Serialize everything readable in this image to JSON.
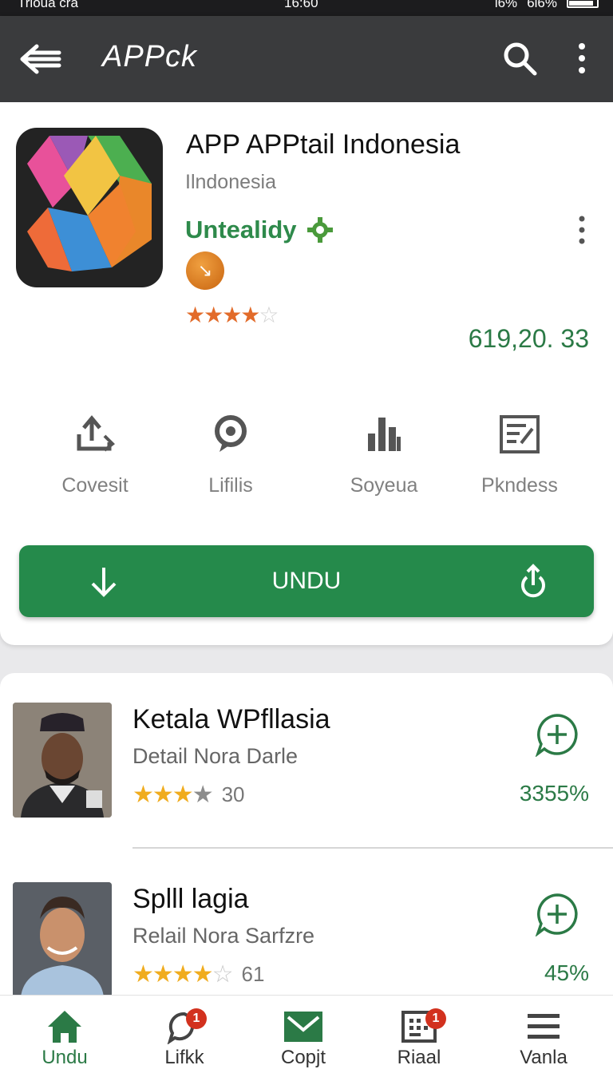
{
  "status_bar": {
    "carrier": "Trioua cra",
    "time": "16:60",
    "signal_text": "l6%",
    "battery_text": "6l6%"
  },
  "app_bar": {
    "title": "APPck"
  },
  "app": {
    "name": "APP APPtail Indonesia",
    "subtitle": "Ilndonesia",
    "developer": "Untealidy",
    "rating": 4,
    "rating_max": 5,
    "price": "619,20. 33",
    "icon": "app-logo-icon",
    "brand_color": "#2e8a4b"
  },
  "actions": [
    {
      "label": "Covesit",
      "icon": "share-upload-icon"
    },
    {
      "label": "Lifilis",
      "icon": "location-pin-icon"
    },
    {
      "label": "Soyeua",
      "icon": "bar-chart-icon"
    },
    {
      "label": "Pkndess",
      "icon": "edit-note-icon"
    }
  ],
  "download_button": {
    "label": "UNDU",
    "color": "#258a4b"
  },
  "list": [
    {
      "name": "Ketala WPfllasia",
      "detail": "Detail Nora Darle",
      "rating": 3.5,
      "count": "30",
      "percent": "3355%"
    },
    {
      "name": "Splll lagia",
      "detail": "Relail Nora Sarfzre",
      "rating": 4,
      "count": "61",
      "percent": "45%"
    }
  ],
  "bottom_nav": [
    {
      "label": "Undu",
      "icon": "home-icon",
      "active": true,
      "badge": ""
    },
    {
      "label": "Lifkk",
      "icon": "chat-icon",
      "active": false,
      "badge": "1"
    },
    {
      "label": "Copjt",
      "icon": "mail-icon",
      "active": false,
      "badge": ""
    },
    {
      "label": "Riaal",
      "icon": "grid-icon",
      "active": false,
      "badge": "1"
    },
    {
      "label": "Vanla",
      "icon": "menu-icon",
      "active": false,
      "badge": ""
    }
  ]
}
